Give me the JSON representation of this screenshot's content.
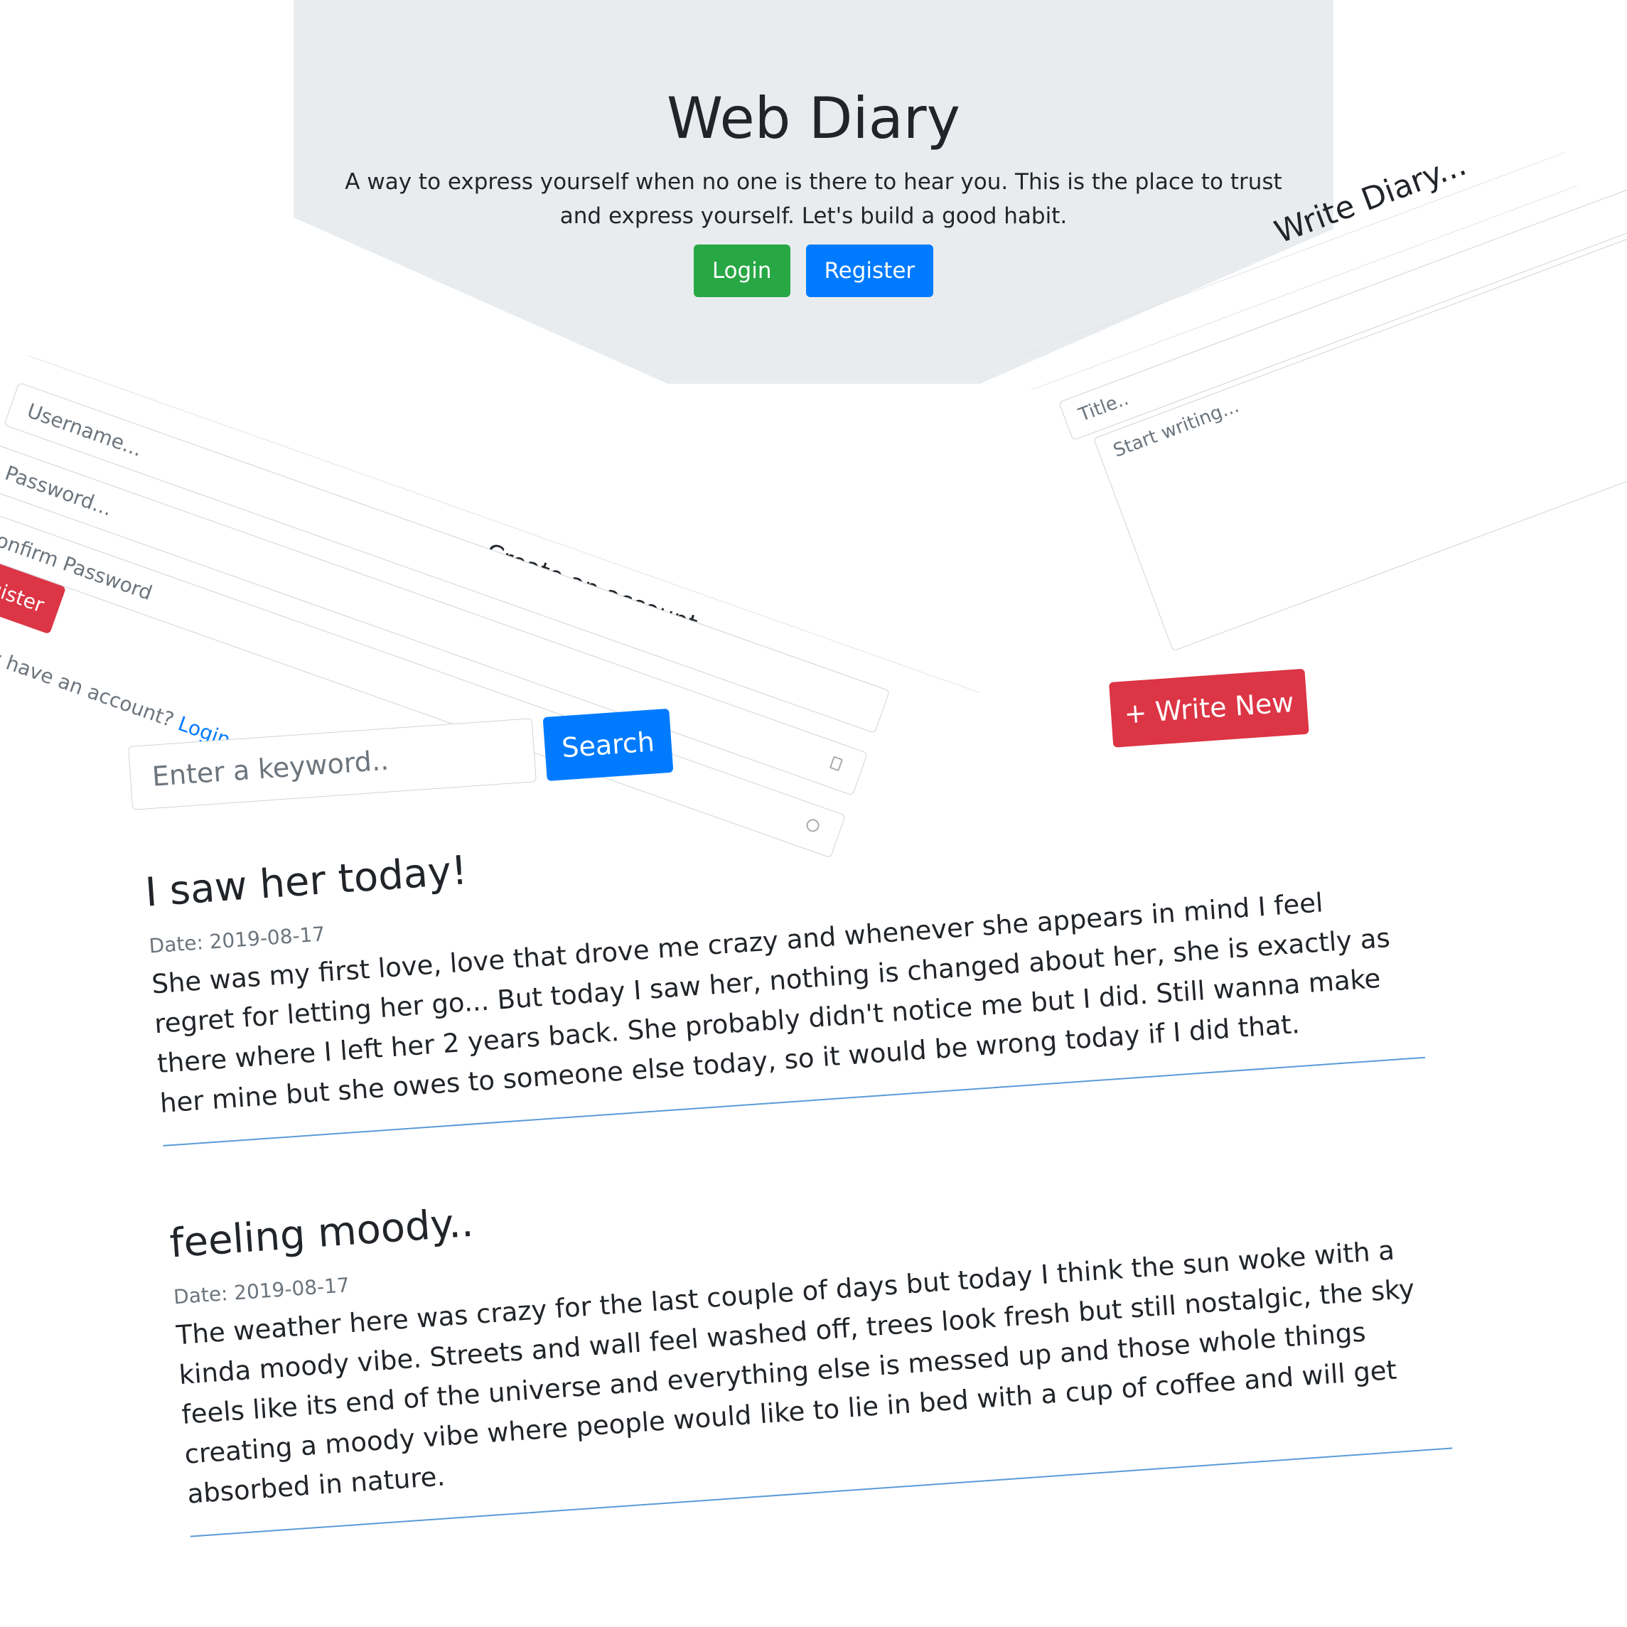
{
  "hero": {
    "title": "Web Diary",
    "subtitle": "A way to express yourself when no one is there to hear you. This is the place to trust and express yourself. Let's build a good habit.",
    "login_label": "Login",
    "register_label": "Register"
  },
  "register_form": {
    "title": "Create an account",
    "username_placeholder": "Username...",
    "password_placeholder": "Password...",
    "confirm_placeholder": "Confirm Password",
    "submit_label": "Register",
    "footer_text": "Already have an account?",
    "login_link": "Login"
  },
  "write_form": {
    "title": "Write Diary...",
    "title_placeholder": "Title..",
    "body_placeholder": "Start writing..."
  },
  "write_new_label": "+ Write New",
  "search": {
    "placeholder": "Enter a keyword..",
    "button_label": "Search"
  },
  "entries": [
    {
      "title": "I saw her today!",
      "date": "Date: 2019-08-17",
      "body": "She was my first love, love that drove me crazy and whenever she appears in mind I feel regret for letting her go... But today I saw her, nothing is changed about her, she is exactly as there where I left her 2 years back. She probably didn't notice me but I did. Still wanna make her mine but she owes to someone else today, so it would be wrong today if I did that."
    },
    {
      "title": "feeling moody..",
      "date": "Date: 2019-08-17",
      "body": "The weather here was crazy for the last couple of days but today I think the sun woke with a kinda moody vibe. Streets and wall feel washed off, trees look fresh but still nostalgic, the sky feels like its end of the universe and everything else is messed up and those whole things creating a moody vibe where people would like to lie in bed with a cup of coffee and will get absorbed in nature."
    }
  ],
  "colors": {
    "hero_bg": "#e9ecef",
    "green": "#28a745",
    "blue": "#007bff",
    "red": "#dc3545",
    "rule": "#5b9ad8"
  }
}
